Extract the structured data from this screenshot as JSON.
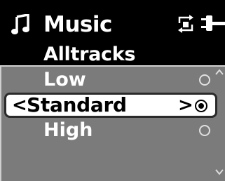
{
  "header": {
    "title": "Music",
    "icons": [
      "music-note-icon",
      "repeat-icon",
      "battery-icon"
    ]
  },
  "menu": {
    "category": "Alltracks",
    "options": [
      {
        "label": "Low",
        "selected": false
      },
      {
        "label": "Standard",
        "selected": true
      },
      {
        "label": "High",
        "selected": false
      }
    ]
  },
  "selection": {
    "left_arrow": "<",
    "right_arrow": ">"
  },
  "colors": {
    "background": "#000000",
    "panel": "#7b7b7b",
    "highlight": "#ffffff",
    "text": "#ffffff"
  }
}
